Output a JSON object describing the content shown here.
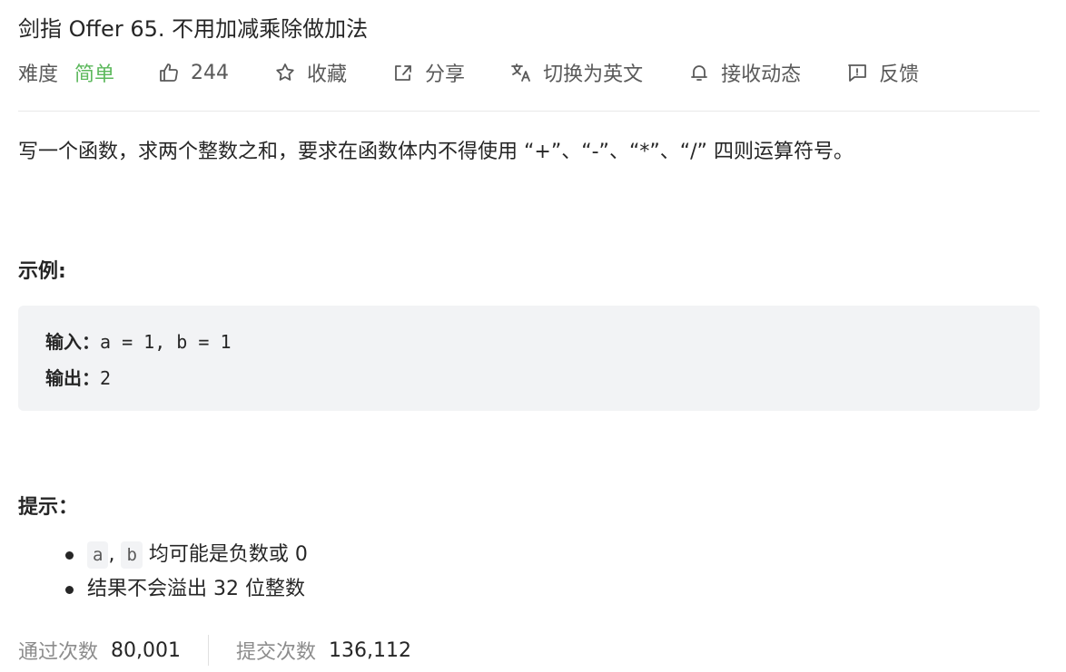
{
  "problem": {
    "title": "剑指 Offer 65. 不用加减乘除做加法",
    "difficulty_label": "难度",
    "difficulty_value": "简单",
    "likes": "244",
    "favorite_label": "收藏",
    "share_label": "分享",
    "switch_lang_label": "切换为英文",
    "notify_label": "接收动态",
    "feedback_label": "反馈"
  },
  "description": "写一个函数，求两个整数之和，要求在函数体内不得使用 “+”、“-”、“*”、“/” 四则运算符号。",
  "example": {
    "title": "示例:",
    "input_label": "输入：",
    "input_value": "a = 1, b = 1",
    "output_label": "输出：",
    "output_value": "2"
  },
  "hints": {
    "title": "提示：",
    "items": [
      {
        "code_a": "a",
        "sep": ",",
        "code_b": "b",
        "text": "均可能是负数或 0"
      },
      {
        "text": "结果不会溢出 32 位整数"
      }
    ]
  },
  "stats": {
    "accepted_label": "通过次数",
    "accepted_value": "80,001",
    "submitted_label": "提交次数",
    "submitted_value": "136,112"
  },
  "icons": {
    "like": "thumbs-up-icon",
    "favorite": "star-icon",
    "share": "share-icon",
    "translate": "translate-icon",
    "notify": "bell-icon",
    "feedback": "feedback-icon"
  },
  "colors": {
    "difficulty_easy": "#5cb85c",
    "text": "#262626",
    "muted": "#8c8c8c",
    "code_bg": "#f2f3f5"
  }
}
